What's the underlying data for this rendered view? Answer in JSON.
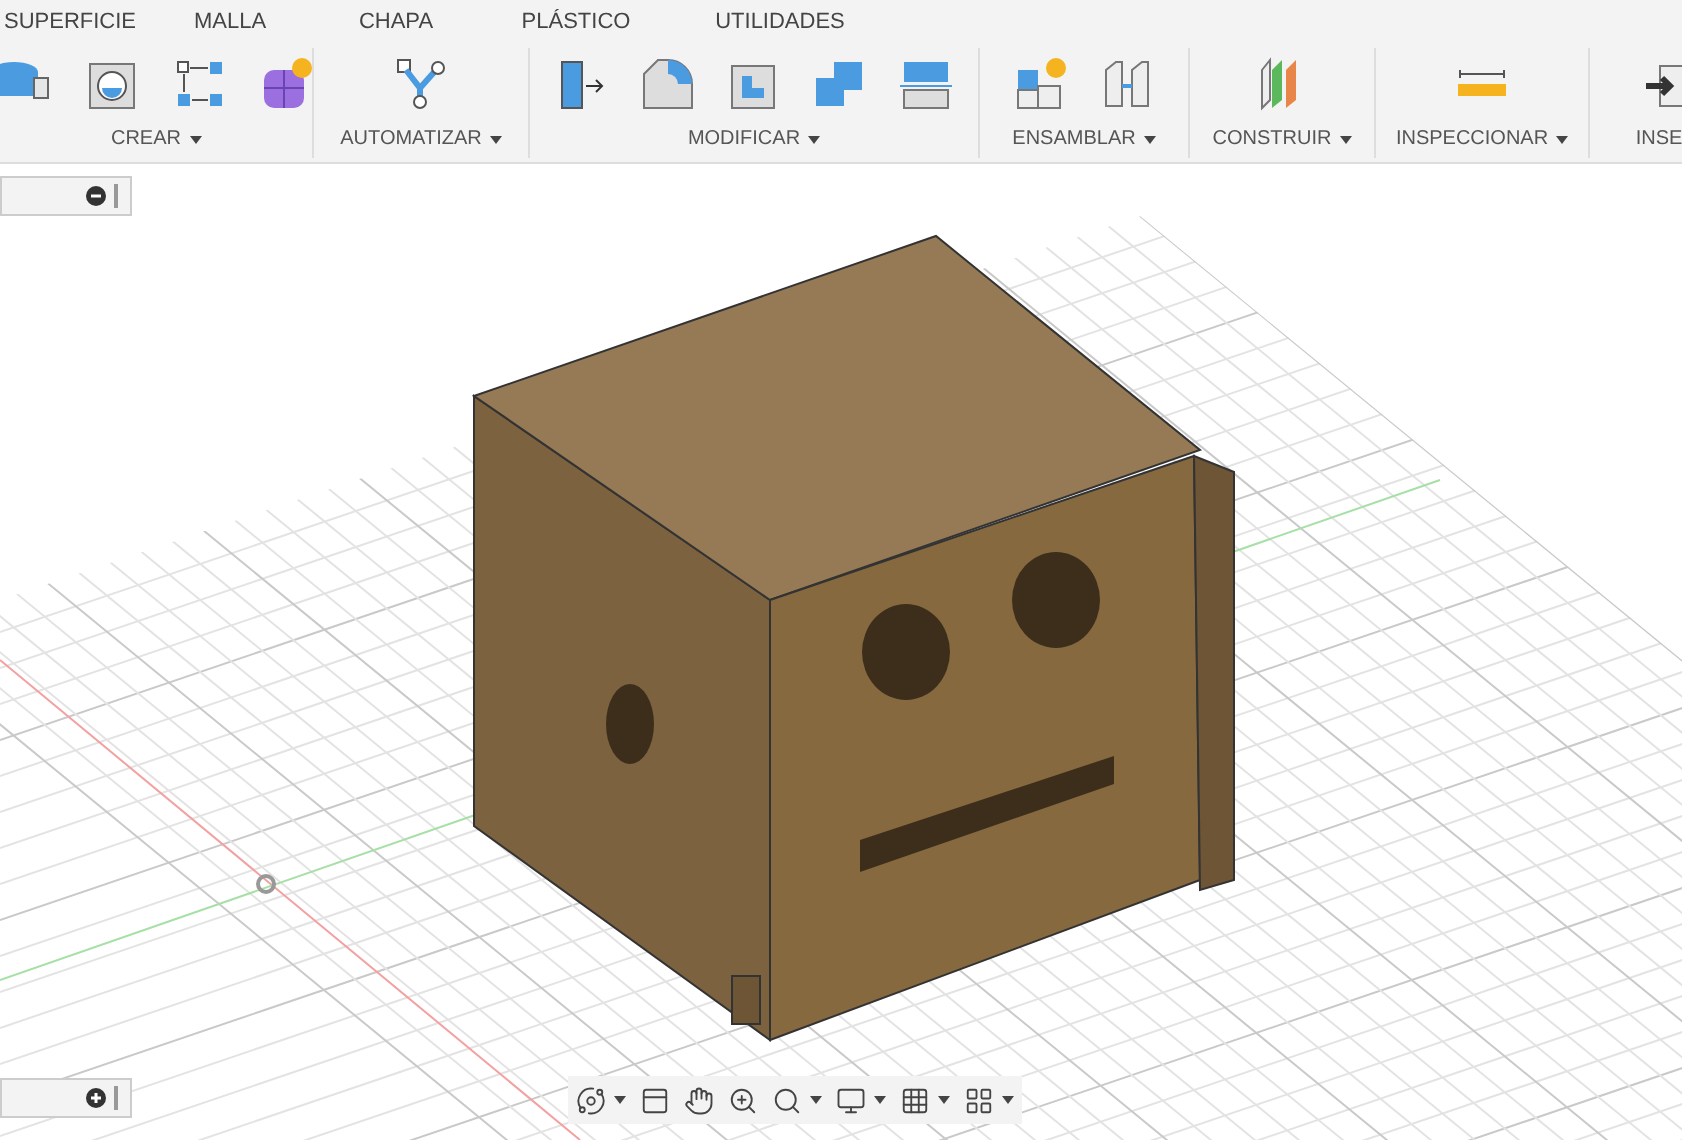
{
  "tabs": [
    {
      "label": "SUPERFICIE",
      "selected": false
    },
    {
      "label": "MALLA",
      "selected": false
    },
    {
      "label": "CHAPA",
      "selected": false
    },
    {
      "label": "PLÁSTICO",
      "selected": false
    },
    {
      "label": "UTILIDADES",
      "selected": false
    }
  ],
  "groups": [
    {
      "label": "CREAR"
    },
    {
      "label": "AUTOMATIZAR"
    },
    {
      "label": "MODIFICAR"
    },
    {
      "label": "ENSAMBLAR"
    },
    {
      "label": "CONSTRUIR"
    },
    {
      "label": "INSPECCIONAR"
    },
    {
      "label": "INSE"
    }
  ],
  "panels": [
    {
      "expanded": true
    },
    {
      "expanded": false
    }
  ]
}
